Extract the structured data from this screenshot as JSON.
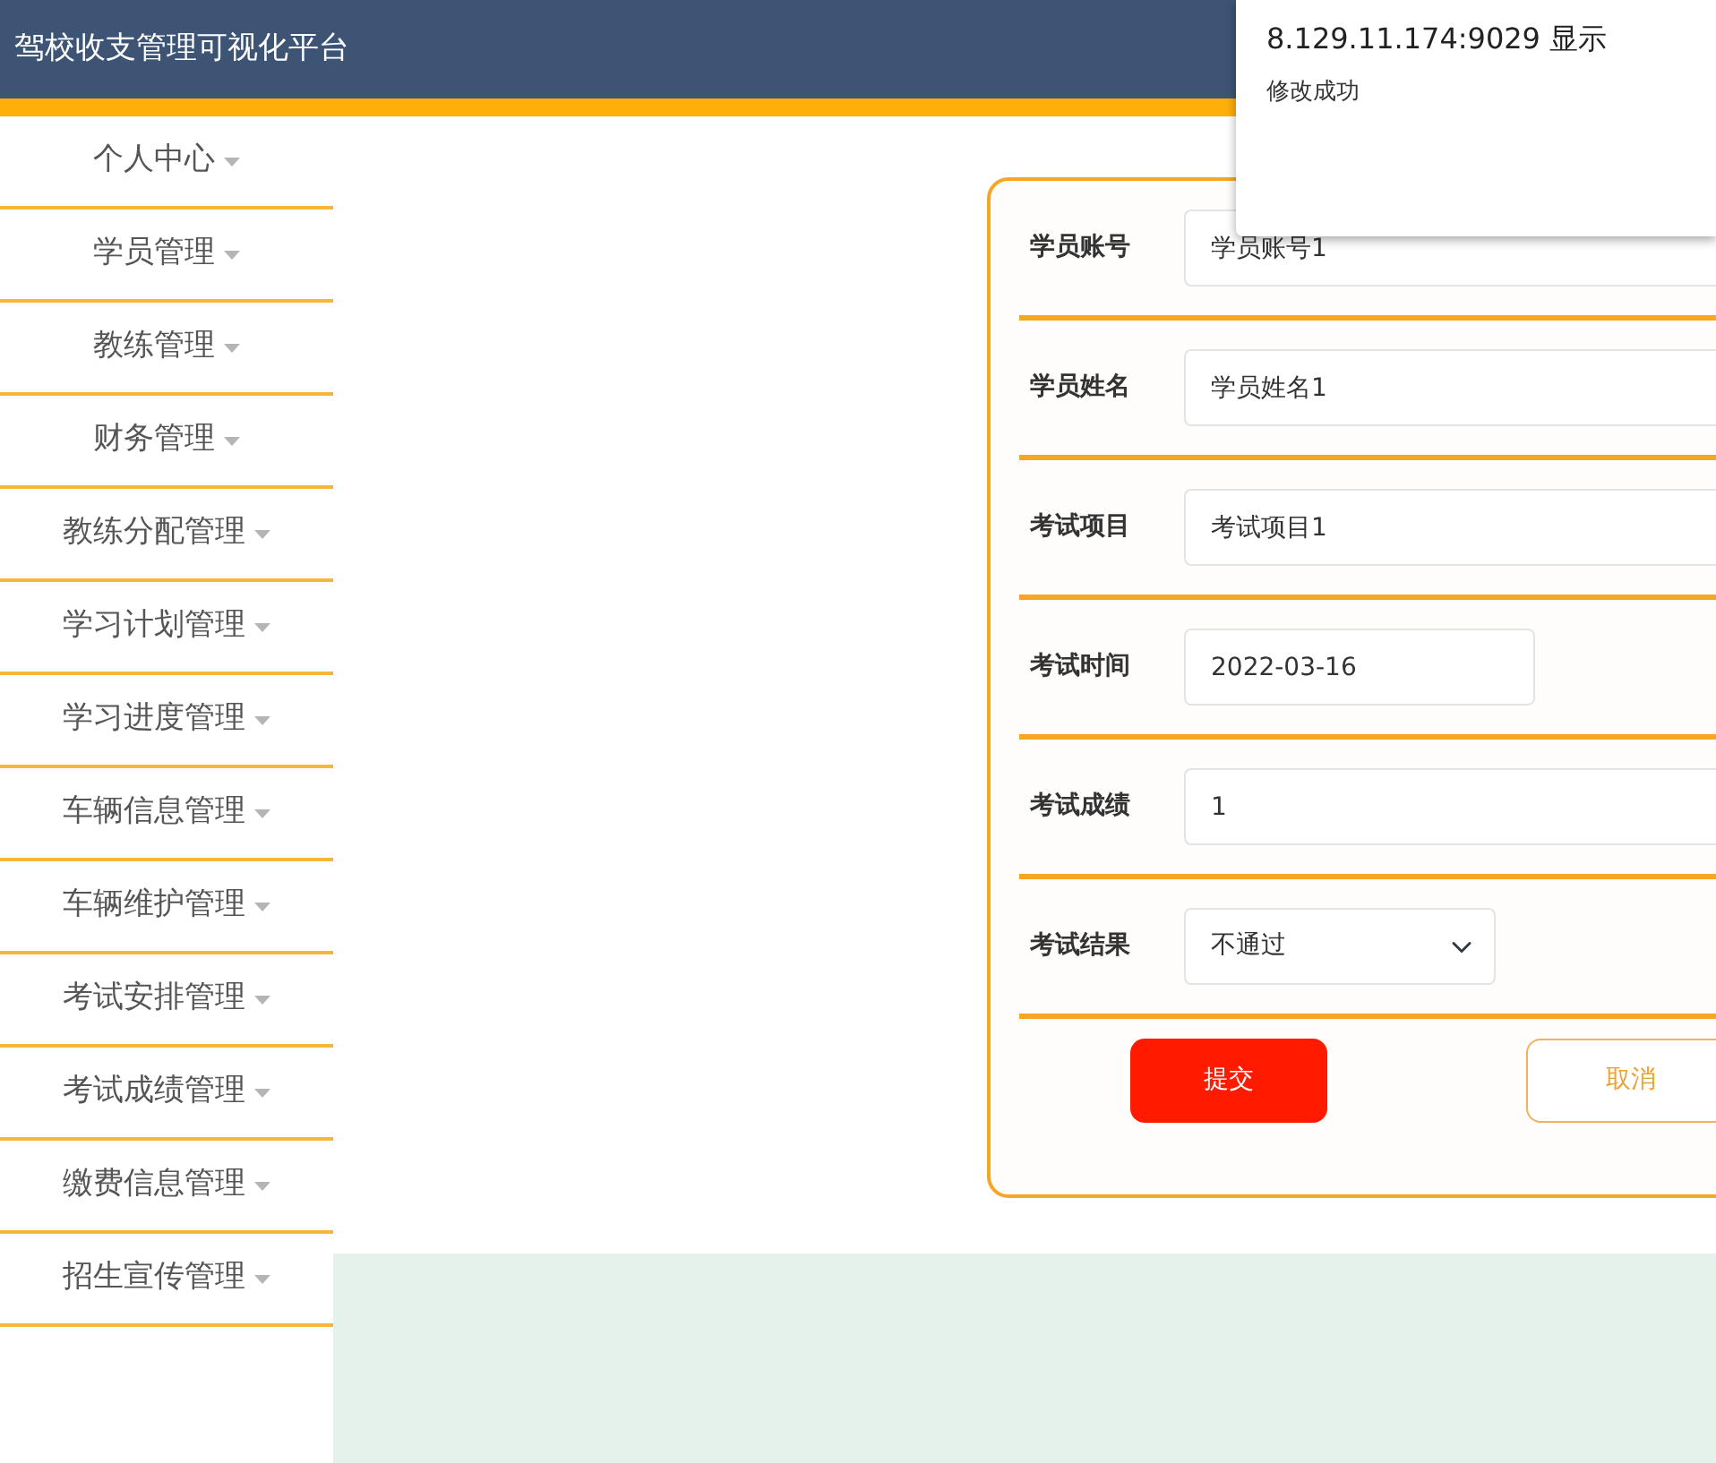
{
  "header": {
    "title": "驾校收支管理可视化平台"
  },
  "sidebar": {
    "items": [
      {
        "label": "个人中心"
      },
      {
        "label": "学员管理"
      },
      {
        "label": "教练管理"
      },
      {
        "label": "财务管理"
      },
      {
        "label": "教练分配管理"
      },
      {
        "label": "学习计划管理"
      },
      {
        "label": "学习进度管理"
      },
      {
        "label": "车辆信息管理"
      },
      {
        "label": "车辆维护管理"
      },
      {
        "label": "考试安排管理"
      },
      {
        "label": "考试成绩管理"
      },
      {
        "label": "缴费信息管理"
      },
      {
        "label": "招生宣传管理"
      }
    ]
  },
  "form": {
    "fields": [
      {
        "label": "学员账号",
        "kind": "text",
        "value": "学员账号1"
      },
      {
        "label": "学员姓名",
        "kind": "text",
        "value": "学员姓名1"
      },
      {
        "label": "考试项目",
        "kind": "text",
        "value": "考试项目1"
      },
      {
        "label": "考试时间",
        "kind": "date",
        "value": "2022-03-16"
      },
      {
        "label": "考试成绩",
        "kind": "text",
        "value": "1"
      },
      {
        "label": "考试结果",
        "kind": "select",
        "value": "不通过"
      }
    ],
    "buttons": [
      {
        "label": "提交",
        "kind": "primary"
      },
      {
        "label": "取消",
        "kind": "secondary"
      }
    ]
  },
  "dialog": {
    "title": "8.129.11.174:9029 显示",
    "message": "修改成功"
  }
}
